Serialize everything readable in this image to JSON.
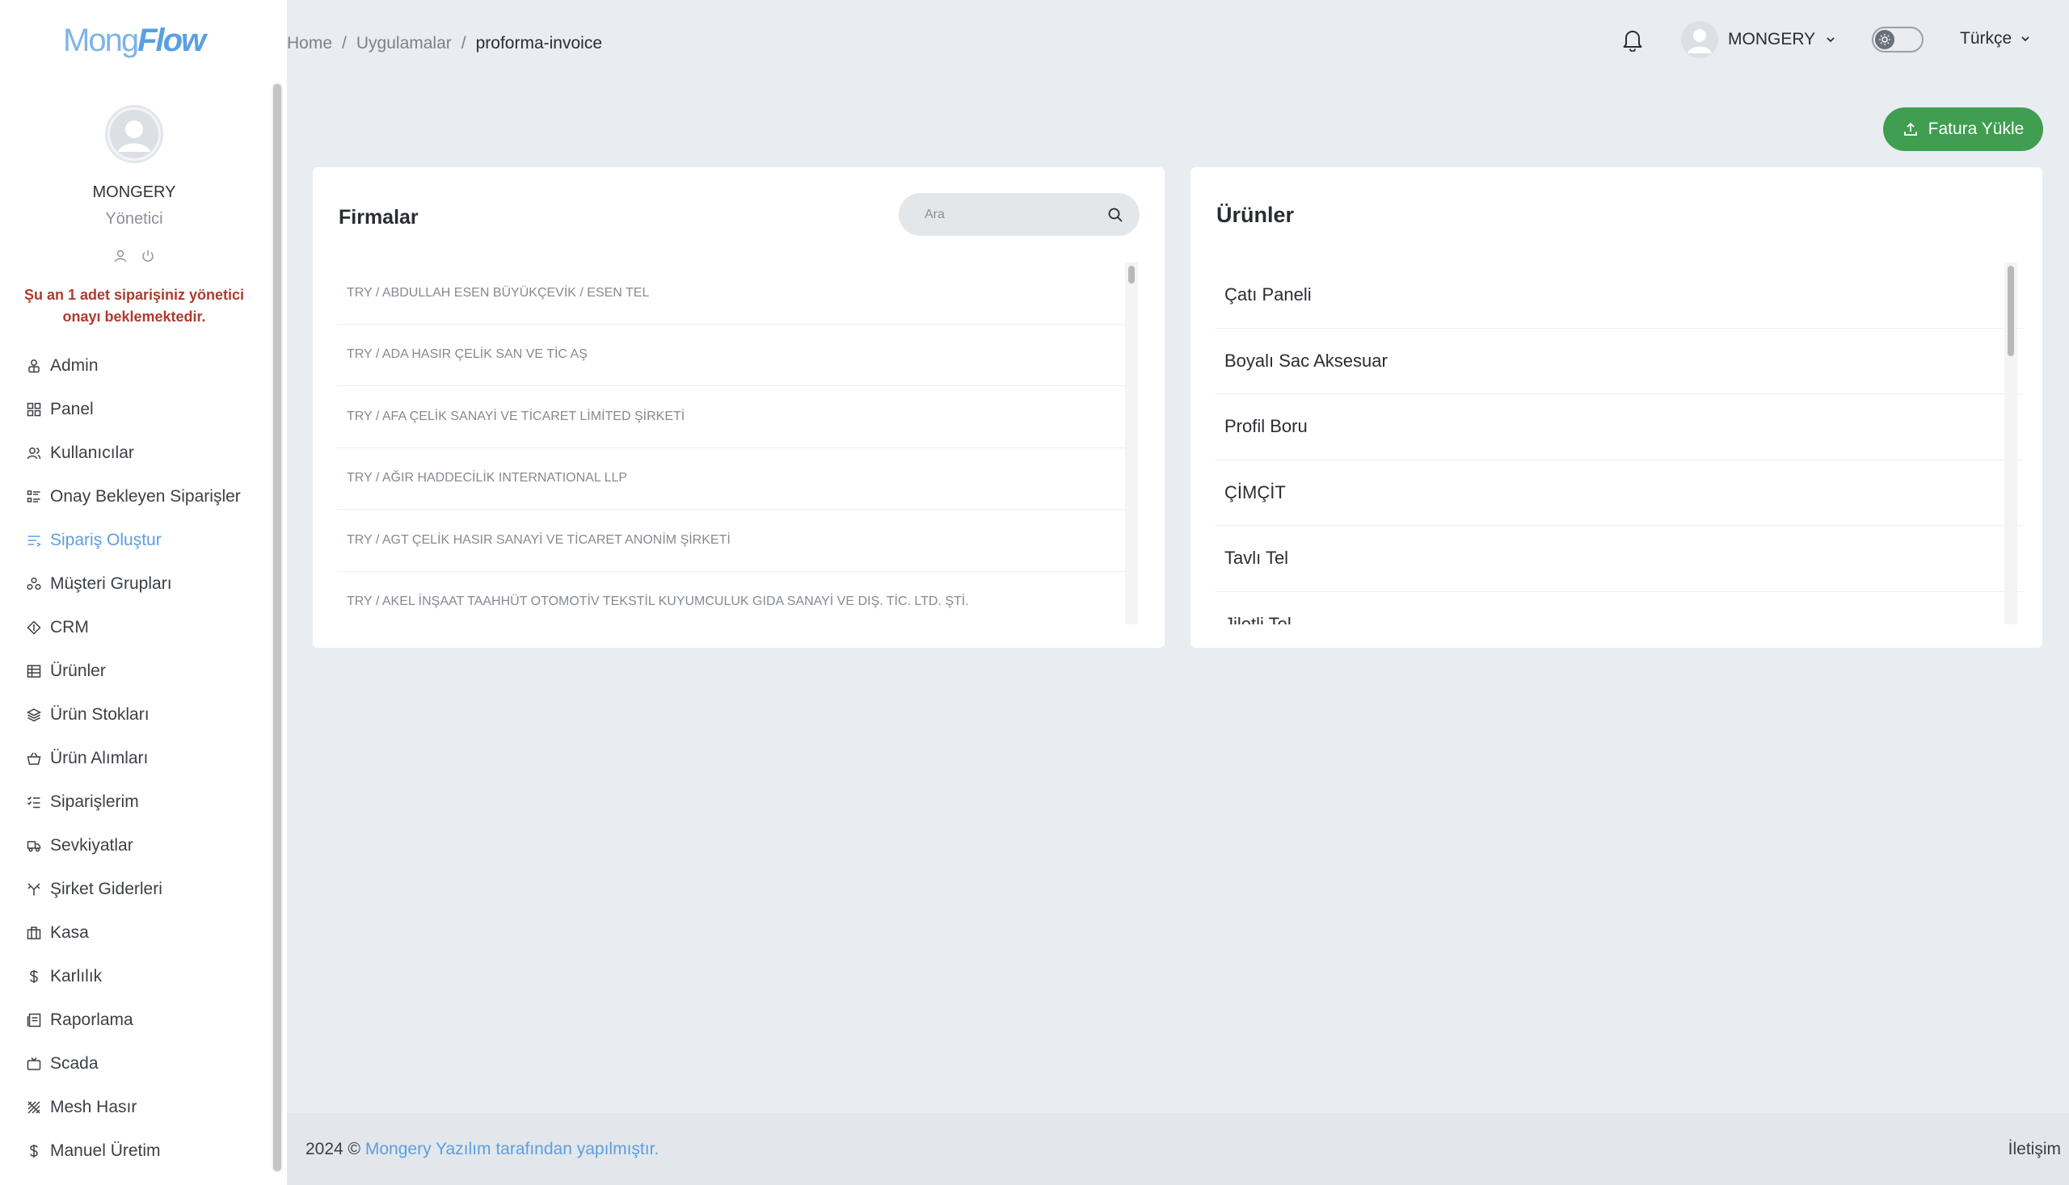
{
  "logo": {
    "part1": "Mong",
    "part2": "Flow"
  },
  "profile": {
    "name": "MONGERY",
    "role": "Yönetici"
  },
  "warning": "Şu an 1 adet siparişiniz yönetici onayı beklemektedir.",
  "nav": [
    {
      "label": "Admin",
      "icon": "admin-icon"
    },
    {
      "label": "Panel",
      "icon": "grid-icon"
    },
    {
      "label": "Kullanıcılar",
      "icon": "users-icon"
    },
    {
      "label": "Onay Bekleyen Siparişler",
      "icon": "list-icon"
    },
    {
      "label": "Sipariş Oluştur",
      "icon": "form-icon",
      "active": true
    },
    {
      "label": "Müşteri Grupları",
      "icon": "group-icon"
    },
    {
      "label": "CRM",
      "icon": "crm-icon"
    },
    {
      "label": "Ürünler",
      "icon": "table-icon"
    },
    {
      "label": "Ürün Stokları",
      "icon": "layers-icon"
    },
    {
      "label": "Ürün Alımları",
      "icon": "basket-icon"
    },
    {
      "label": "Siparişlerim",
      "icon": "checklist-icon"
    },
    {
      "label": "Sevkiyatlar",
      "icon": "truck-icon"
    },
    {
      "label": "Şirket Giderleri",
      "icon": "expense-icon"
    },
    {
      "label": "Kasa",
      "icon": "cashbox-icon"
    },
    {
      "label": "Karlılık",
      "icon": "dollar-icon"
    },
    {
      "label": "Raporlama",
      "icon": "report-icon"
    },
    {
      "label": "Scada",
      "icon": "tv-icon"
    },
    {
      "label": "Mesh Hasır",
      "icon": "mesh-icon"
    },
    {
      "label": "Manuel Üretim",
      "icon": "dollar-icon"
    }
  ],
  "breadcrumb": {
    "home": "Home",
    "apps": "Uygulamalar",
    "current": "proforma-invoice",
    "separator": "/"
  },
  "header": {
    "username": "MONGERY",
    "language": "Türkçe"
  },
  "upload_button": "Fatura Yükle",
  "companies": {
    "title": "Firmalar",
    "search_placeholder": "Ara",
    "rows": [
      "TRY / ABDULLAH ESEN BÜYÜKÇEVİK / ESEN TEL",
      "TRY / ADA HASIR ÇELİK SAN VE TİC AŞ",
      "TRY / AFA ÇELİK SANAYİ VE TİCARET LİMİTED ŞİRKETİ",
      "TRY / AĞIR HADDECİLİK INTERNATIONAL LLP",
      "TRY / AGT ÇELİK HASIR SANAYİ VE TİCARET ANONİM ŞİRKETİ",
      "TRY / AKEL İNŞAAT TAAHHÜT OTOMOTİV TEKSTİL KUYUMCULUK GIDA SANAYİ VE DIŞ. TİC. LTD. ŞTİ."
    ]
  },
  "products": {
    "title": "Ürünler",
    "rows": [
      "Çatı Paneli",
      "Boyalı Sac Aksesuar",
      "Profil Boru",
      "ÇİMÇİT",
      "Tavlı Tel",
      "Jiletli Tel"
    ]
  },
  "footer": {
    "prefix": "2024 ©",
    "link": "Mongery Yazılım tarafından yapılmıştır.",
    "contact": "İletişim"
  },
  "colors": {
    "accent": "#5b9fe0",
    "success": "#3f9e4f",
    "warning": "#b03a2e",
    "background": "#e9ecf0"
  }
}
